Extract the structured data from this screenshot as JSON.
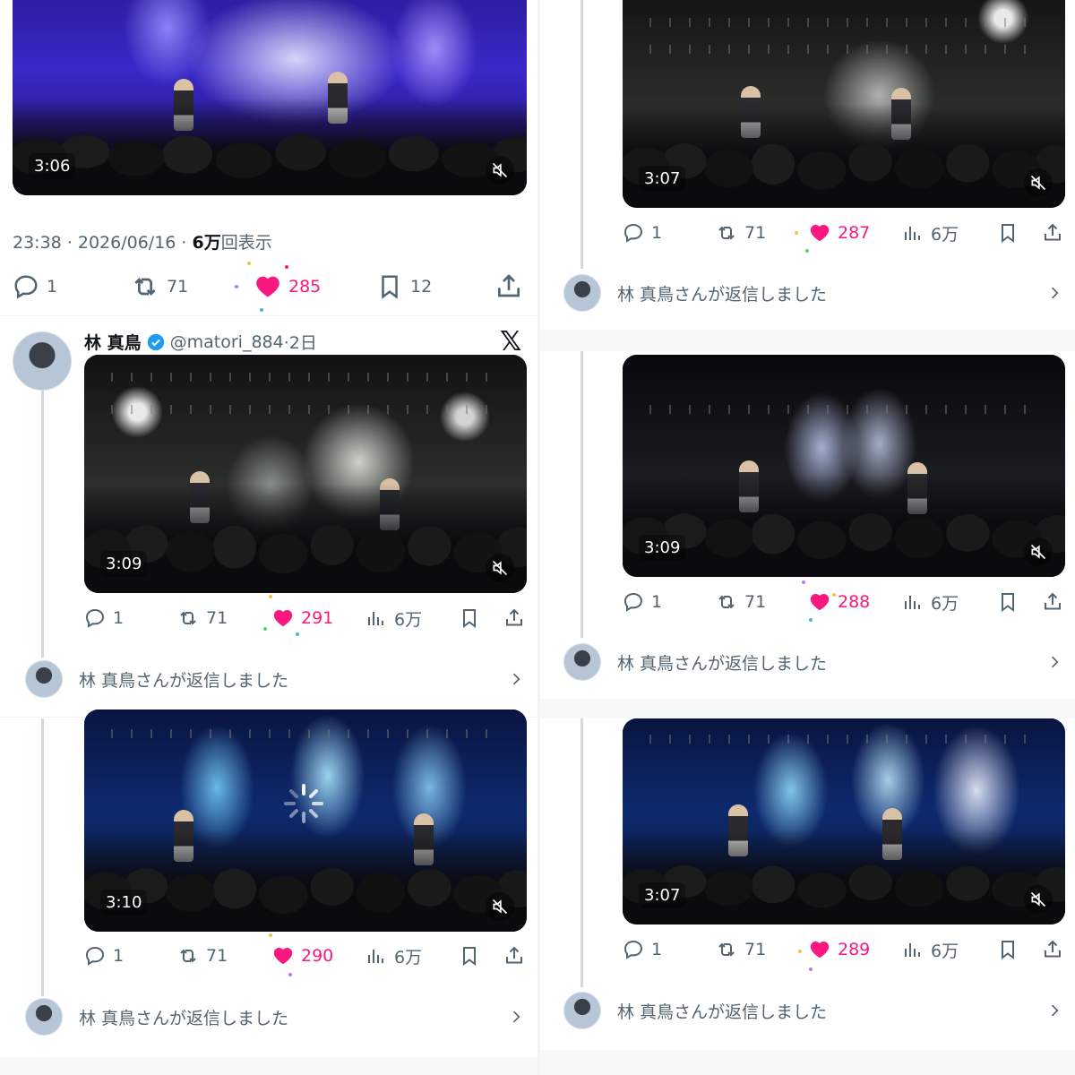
{
  "colors": {
    "like": "#f91880",
    "muted": "#536471",
    "text": "#0f1419"
  },
  "icons": {
    "reply": "reply-icon",
    "repost": "repost-icon",
    "like": "heart-icon",
    "views": "views-icon",
    "bookmark": "bookmark-icon",
    "share": "share-icon",
    "mute": "mute-icon",
    "chevron": "chevron-right-icon",
    "verified": "verified-badge-icon",
    "x": "x-logo-icon"
  },
  "reply_text": "林 真鳥さんが返信しました",
  "left": {
    "top_tweet": {
      "duration": "3:06",
      "meta_time": "23:38 · 2026/06/16 · ",
      "meta_views": "6万",
      "meta_suffix": "回表示",
      "replies": "1",
      "reposts": "71",
      "likes": "285",
      "bookmarks": "12"
    },
    "tweet2": {
      "name": "林 真鳥",
      "handle": "@matori_884",
      "time": "·2日",
      "duration": "3:09",
      "replies": "1",
      "reposts": "71",
      "likes": "291",
      "views": "6万"
    },
    "tweet3": {
      "duration": "3:10",
      "replies": "1",
      "reposts": "71",
      "likes": "290",
      "views": "6万"
    }
  },
  "right": {
    "tweet1": {
      "duration": "3:07",
      "replies": "1",
      "reposts": "71",
      "likes": "287",
      "views": "6万"
    },
    "tweet2": {
      "duration": "3:09",
      "replies": "1",
      "reposts": "71",
      "likes": "288",
      "views": "6万"
    },
    "tweet3": {
      "duration": "3:07",
      "replies": "1",
      "reposts": "71",
      "likes": "289",
      "views": "6万"
    }
  }
}
